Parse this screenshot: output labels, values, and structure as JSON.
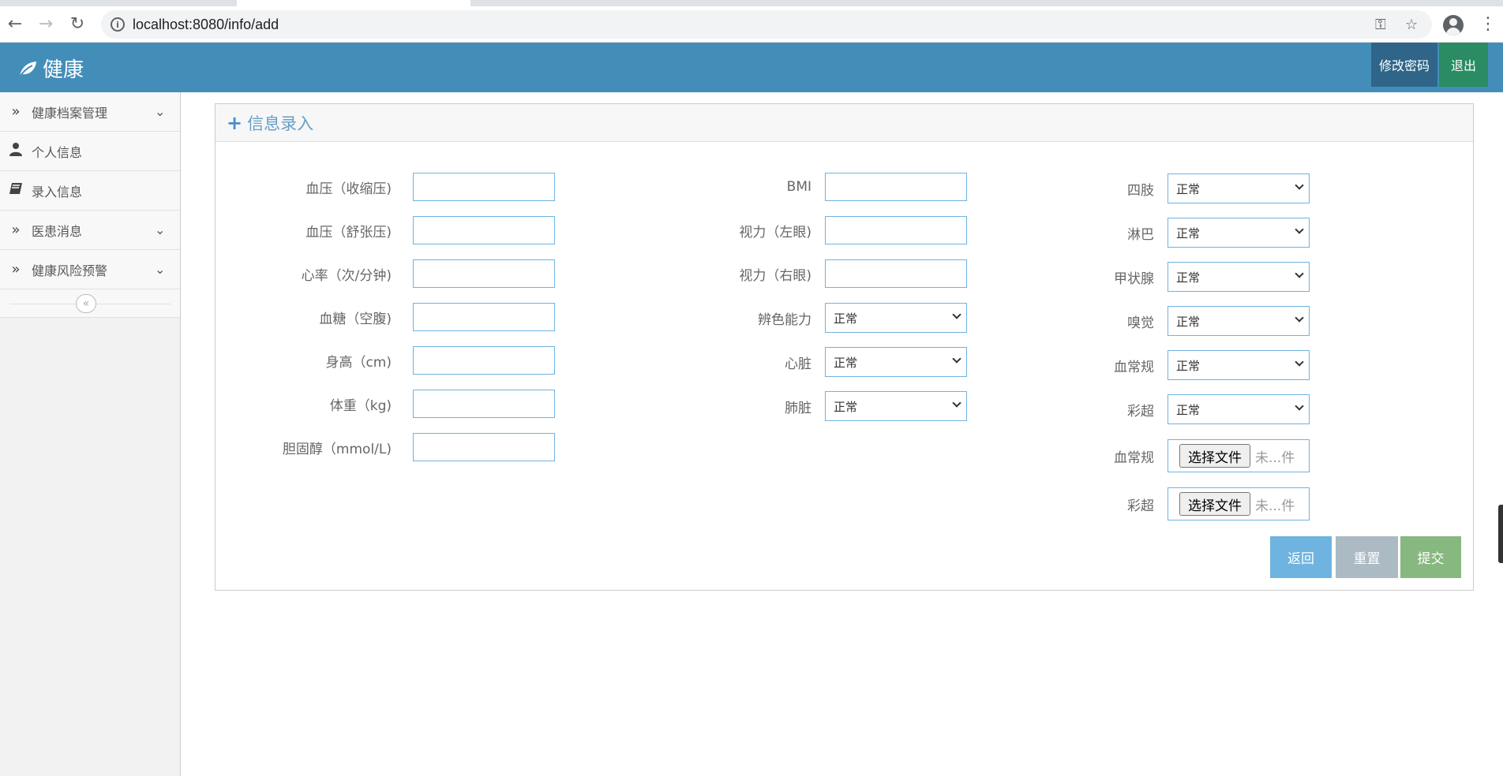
{
  "browser": {
    "url": "localhost:8080/info/add",
    "icons": [
      "back-icon",
      "forward-icon",
      "reload-icon",
      "info-icon",
      "key-icon",
      "star-icon",
      "profile-icon",
      "menu-icon"
    ]
  },
  "header": {
    "brand": "健康",
    "change_password": "修改密码",
    "logout": "退出",
    "color": "#438eb9"
  },
  "sidebar": {
    "items": [
      {
        "label": "健康档案管理",
        "icon": "double-chevron-right-icon",
        "expandable": true
      },
      {
        "label": "个人信息",
        "icon": "user-icon",
        "expandable": false
      },
      {
        "label": "录入信息",
        "icon": "book-icon",
        "expandable": false
      },
      {
        "label": "医患消息",
        "icon": "double-chevron-right-icon",
        "expandable": true
      },
      {
        "label": "健康风险预警",
        "icon": "double-chevron-right-icon",
        "expandable": true
      }
    ]
  },
  "form": {
    "title": "信息录入",
    "col1": [
      {
        "label": "血压（收缩压)",
        "value": ""
      },
      {
        "label": "血压（舒张压)",
        "value": ""
      },
      {
        "label": "心率（次/分钟)",
        "value": ""
      },
      {
        "label": "血糖（空腹)",
        "value": ""
      },
      {
        "label": "身高（cm)",
        "value": ""
      },
      {
        "label": "体重（kg)",
        "value": ""
      },
      {
        "label": "胆固醇（mmol/L)",
        "value": ""
      }
    ],
    "col2": [
      {
        "label": "BMI",
        "type": "text",
        "value": ""
      },
      {
        "label": "视力（左眼)",
        "type": "text",
        "value": ""
      },
      {
        "label": "视力（右眼)",
        "type": "text",
        "value": ""
      },
      {
        "label": "辨色能力",
        "type": "select",
        "value": "正常"
      },
      {
        "label": "心脏",
        "type": "select",
        "value": "正常"
      },
      {
        "label": "肺脏",
        "type": "select",
        "value": "正常"
      }
    ],
    "col3": [
      {
        "label": "四肢",
        "type": "select",
        "value": "正常"
      },
      {
        "label": "淋巴",
        "type": "select",
        "value": "正常"
      },
      {
        "label": "甲状腺",
        "type": "select",
        "value": "正常"
      },
      {
        "label": "嗅觉",
        "type": "select",
        "value": "正常"
      },
      {
        "label": "血常规",
        "type": "select",
        "value": "正常"
      },
      {
        "label": "彩超",
        "type": "select",
        "value": "正常"
      },
      {
        "label": "血常规",
        "type": "file",
        "button": "选择文件",
        "filename": "未...件"
      },
      {
        "label": "彩超",
        "type": "file",
        "button": "选择文件",
        "filename": "未...件"
      }
    ],
    "buttons": {
      "back": "返回",
      "reset": "重置",
      "submit": "提交"
    }
  }
}
